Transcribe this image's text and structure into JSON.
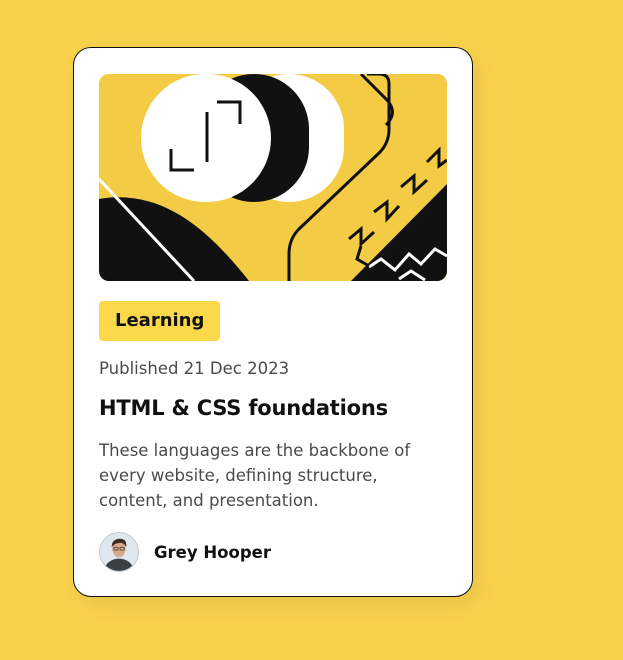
{
  "card": {
    "tag": "Learning",
    "published": "Published 21 Dec 2023",
    "title": "HTML & CSS foundations",
    "description": "These languages are the backbone of every website, defining structure, content, and presentation.",
    "author": {
      "name": "Grey Hooper",
      "avatar_icon": "author-avatar"
    },
    "hero_icon": "illustration-abstract"
  },
  "colors": {
    "background": "#f9d24c",
    "card": "#ffffff",
    "tag": "#f9d84a",
    "text_dark": "#111111",
    "text_muted": "#4a4a4a"
  }
}
